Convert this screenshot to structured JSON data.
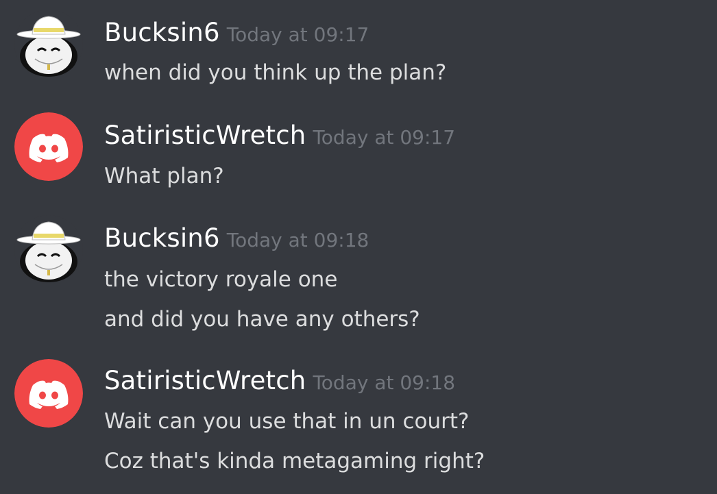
{
  "messages": [
    {
      "author": "Bucksin6",
      "avatar_icon": "bucksin-ball-hat-icon",
      "timestamp": "Today at 09:17",
      "lines": [
        "when did you think up the plan?"
      ]
    },
    {
      "author": "SatiristicWretch",
      "avatar_icon": "discord-default-avatar-icon",
      "avatar_color": "#f04747",
      "timestamp": "Today at 09:17",
      "lines": [
        "What plan?"
      ]
    },
    {
      "author": "Bucksin6",
      "avatar_icon": "bucksin-ball-hat-icon",
      "timestamp": "Today at 09:18",
      "lines": [
        "the victory royale one",
        "and did you have any others?"
      ]
    },
    {
      "author": "SatiristicWretch",
      "avatar_icon": "discord-default-avatar-icon",
      "avatar_color": "#f04747",
      "timestamp": "Today at 09:18",
      "lines": [
        "Wait can you use that in un court?",
        "Coz that's kinda metagaming right?"
      ]
    }
  ]
}
